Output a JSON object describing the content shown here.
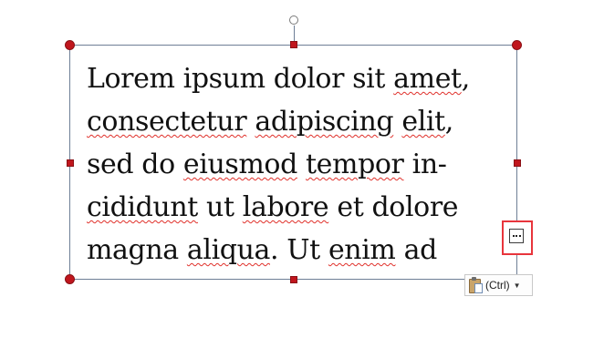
{
  "textbox": {
    "lines": [
      [
        "Lorem ipsum dolor sit ",
        "amet",
        ","
      ],
      [
        "consectetur",
        " ",
        "adipiscing",
        " ",
        "elit",
        ","
      ],
      [
        "sed do ",
        "eiusmod",
        " ",
        "tempor",
        " in-"
      ],
      [
        "cididunt",
        " ut ",
        "labore",
        " et dolore"
      ],
      [
        "magna ",
        "aliqua",
        ". Ut ",
        "enim",
        " ad"
      ]
    ]
  },
  "layout_options": {
    "icon": "layout-options-icon"
  },
  "paste_options": {
    "label": "(Ctrl)",
    "icon": "clipboard-icon",
    "caret_icon": "chevron-down-icon"
  },
  "colors": {
    "selection_handle": "#c0161d",
    "highlight": "#e8353c",
    "spelling": "#e0302a"
  }
}
